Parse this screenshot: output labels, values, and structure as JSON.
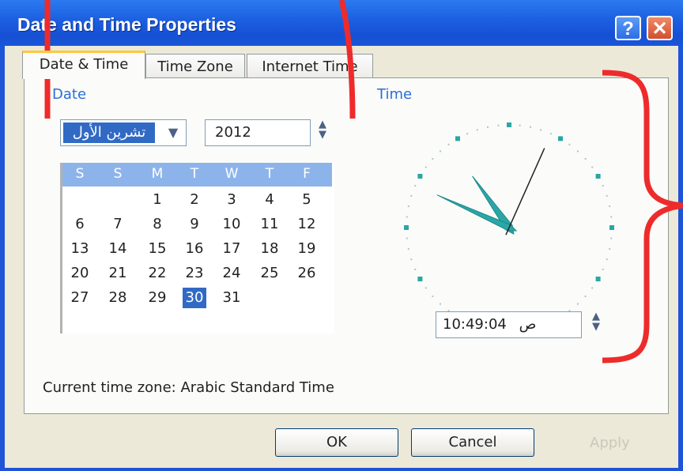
{
  "window": {
    "title": "Date and Time Properties",
    "help_label": "?",
    "close_label": "✕"
  },
  "tabs": [
    {
      "label": "Date & Time",
      "active": true
    },
    {
      "label": "Time Zone",
      "active": false
    },
    {
      "label": "Internet Time",
      "active": false
    }
  ],
  "date": {
    "group_label": "Date",
    "month": "تشرين الأول",
    "year": "2012",
    "weekdays": [
      "S",
      "S",
      "M",
      "T",
      "W",
      "T",
      "F"
    ],
    "weeks": [
      [
        "",
        "",
        "1",
        "2",
        "3",
        "4",
        "5"
      ],
      [
        "6",
        "7",
        "8",
        "9",
        "10",
        "11",
        "12"
      ],
      [
        "13",
        "14",
        "15",
        "16",
        "17",
        "18",
        "19"
      ],
      [
        "20",
        "21",
        "22",
        "23",
        "24",
        "25",
        "26"
      ],
      [
        "27",
        "28",
        "29",
        "30",
        "31",
        "",
        ""
      ]
    ],
    "selected_day": "30"
  },
  "time": {
    "group_label": "Time",
    "value": "10:49:04",
    "ampm": "ص",
    "hours": 10,
    "minutes": 49,
    "seconds": 4
  },
  "timezone": {
    "text": "Current time zone:  Arabic Standard Time"
  },
  "buttons": {
    "ok": "OK",
    "cancel": "Cancel",
    "apply": "Apply"
  },
  "colors": {
    "title_bar": "#1c5fe0",
    "selection": "#316ac5",
    "calendar_header": "#8db4ea",
    "clock_hands": "#2aa6a6",
    "annotation": "#ee2b2b"
  }
}
